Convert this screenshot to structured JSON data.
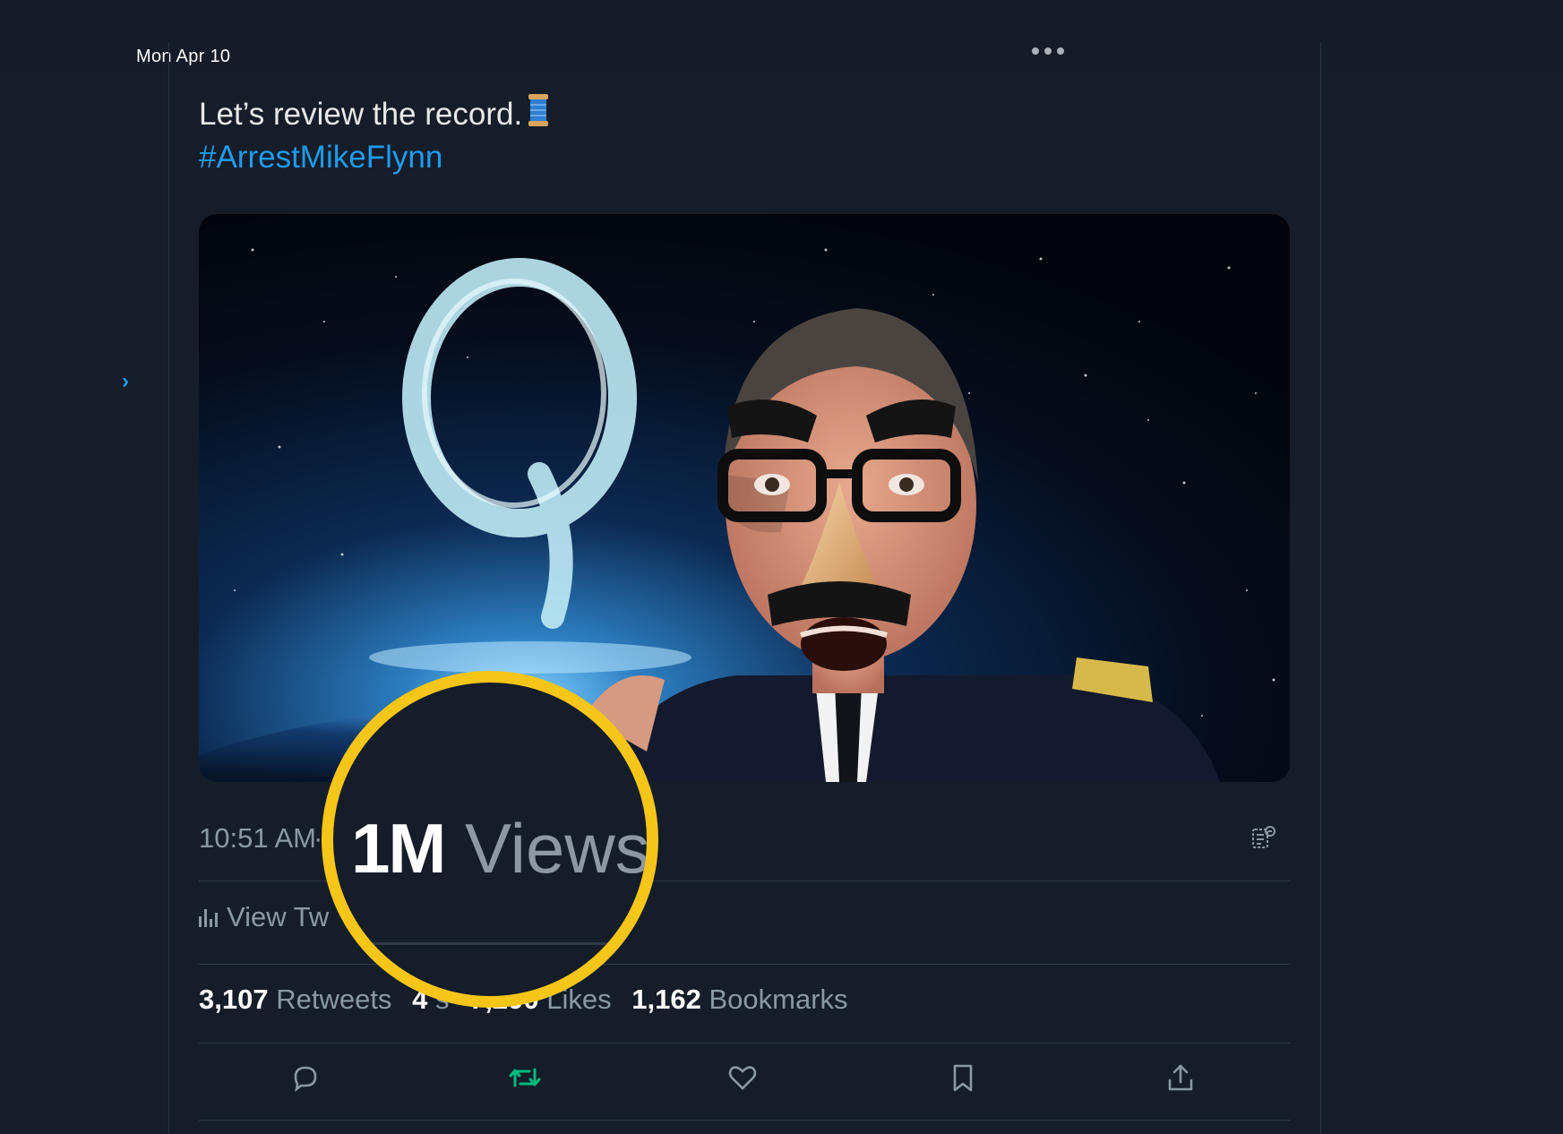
{
  "header": {
    "date": "Mon Apr 10"
  },
  "tweet": {
    "text": "Let’s review the record.",
    "emoji_icon": "thread-spool-icon",
    "hashtag": "#ArrestMikeFlynn",
    "media": {
      "overlay_letter": "Q"
    }
  },
  "meta": {
    "time": "10:51 AM",
    "separator": "·",
    "translate_icon": "translate-icon"
  },
  "analytics": {
    "view_label": "View Tw"
  },
  "zoom_callout": {
    "count": "1M",
    "label": "Views",
    "ring_color": "#f5c518"
  },
  "stats": {
    "retweets": {
      "count": "3,107",
      "label": "Retweets"
    },
    "quotes": {
      "count": "4",
      "label": "s"
    },
    "likes": {
      "count": "7,290",
      "label": "Likes"
    },
    "bookmarks": {
      "count": "1,162",
      "label": "Bookmarks"
    }
  },
  "actions": [
    "reply-icon",
    "retweet-icon",
    "like-icon",
    "bookmark-icon",
    "share-icon"
  ],
  "colors": {
    "background": "#151d29",
    "accent": "#1d9bf0",
    "retweet_active": "#00ba7c"
  }
}
